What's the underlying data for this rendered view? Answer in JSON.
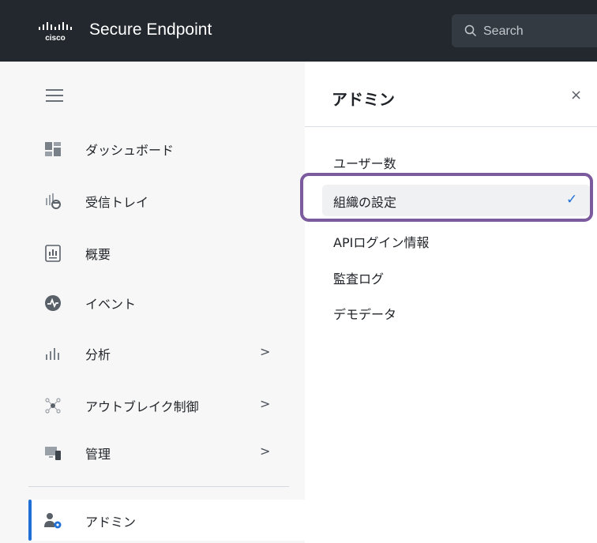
{
  "header": {
    "logo_text": "cisco",
    "app_title": "Secure Endpoint",
    "search": {
      "placeholder": "Search"
    }
  },
  "sidebar": {
    "items": [
      {
        "label": "ダッシュボード",
        "icon": "dashboard-icon",
        "has_submenu": false
      },
      {
        "label": "受信トレイ",
        "icon": "inbox-icon",
        "has_submenu": false
      },
      {
        "label": "概要",
        "icon": "overview-icon",
        "has_submenu": false
      },
      {
        "label": "イベント",
        "icon": "events-icon",
        "has_submenu": false
      },
      {
        "label": "分析",
        "icon": "analysis-icon",
        "has_submenu": true
      },
      {
        "label": "アウトブレイク制御",
        "icon": "outbreak-control-icon",
        "has_submenu": true
      },
      {
        "label": "管理",
        "icon": "management-icon",
        "has_submenu": true
      },
      {
        "label": "アドミン",
        "icon": "admin-icon",
        "has_submenu": false,
        "active": true
      }
    ],
    "chevron": ">"
  },
  "panel": {
    "title": "アドミン",
    "close": "×",
    "items": [
      {
        "label": "ユーザー数"
      },
      {
        "label": "組織の設定",
        "selected": true
      },
      {
        "label": "APIログイン情報"
      },
      {
        "label": "監査ログ"
      },
      {
        "label": "デモデータ"
      }
    ],
    "check": "✓"
  },
  "colors": {
    "topbar": "#23282e",
    "accent": "#1f6fd6",
    "highlight_outline": "#7c5a9e",
    "sidebar_bg": "#f7f7f8"
  }
}
